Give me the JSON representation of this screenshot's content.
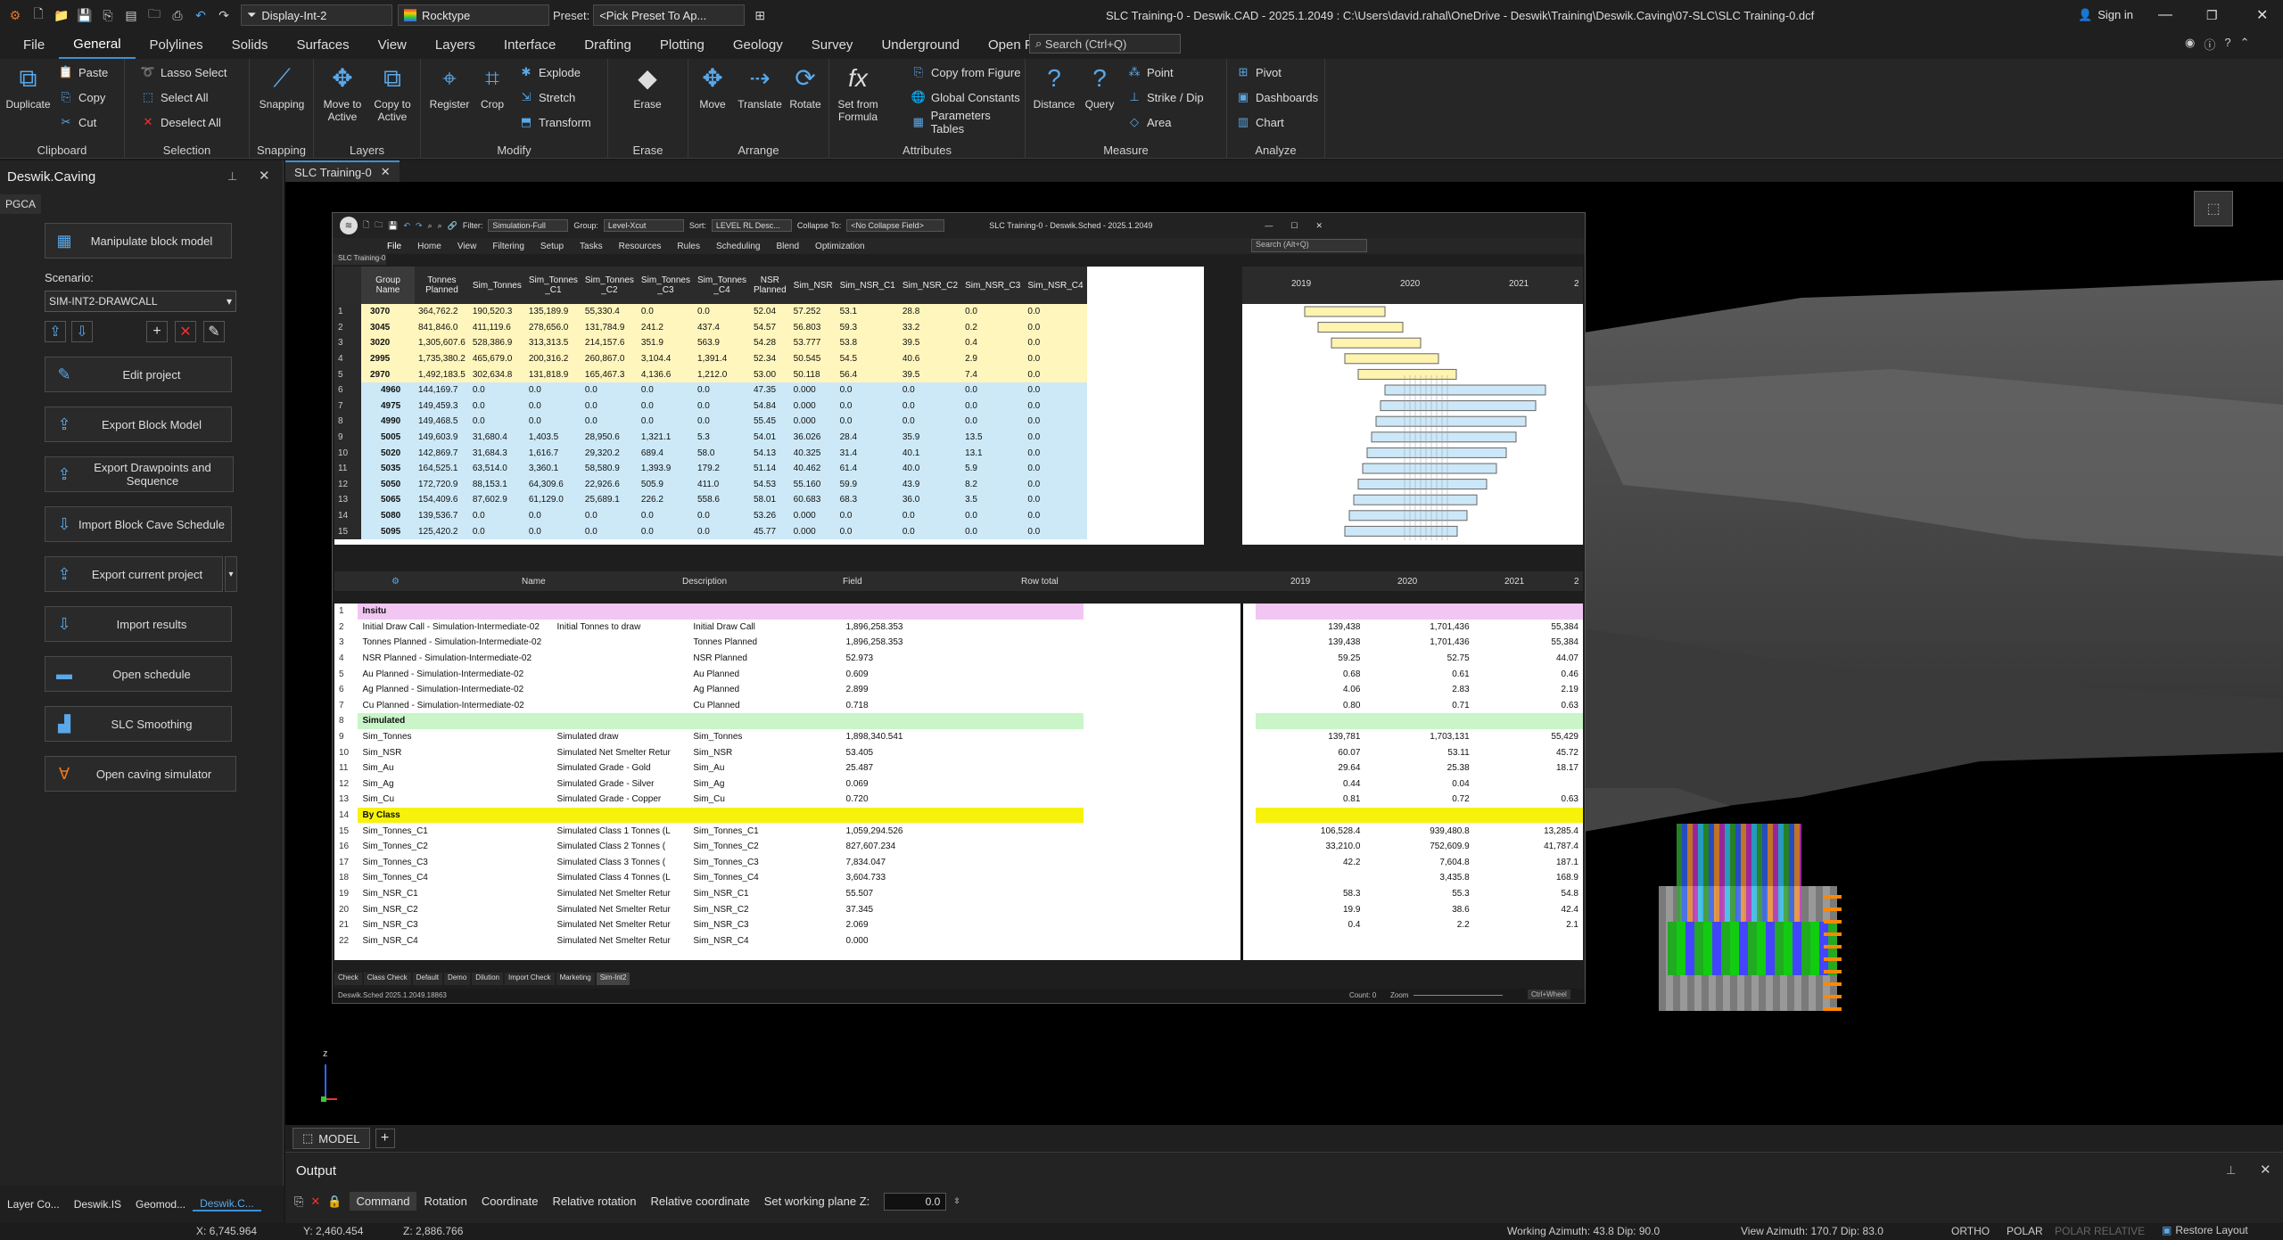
{
  "titlebar": {
    "display": "Display-Int-2",
    "rocktype": "Rocktype",
    "preset_label": "Preset:",
    "preset": "<Pick Preset To Ap...",
    "title": "SLC Training-0 - Deswik.CAD - 2025.1.2049 : C:\\Users\\david.rahal\\OneDrive - Deswik\\Training\\Deswik.Caving\\07-SLC\\SLC Training-0.dcf",
    "signin": "Sign in"
  },
  "tabs": [
    "File",
    "General",
    "Polylines",
    "Solids",
    "Surfaces",
    "View",
    "Layers",
    "Interface",
    "Drafting",
    "Plotting",
    "Geology",
    "Survey",
    "Underground",
    "Open Pit"
  ],
  "search_placeholder": "Search (Ctrl+Q)",
  "ribbon": {
    "groups": [
      "Clipboard",
      "Selection",
      "Snapping",
      "Layers",
      "Modify",
      "Erase",
      "Arrange",
      "Attributes",
      "Measure",
      "Analyze"
    ],
    "duplicate": "Duplicate",
    "paste": "Paste",
    "copy": "Copy",
    "cut": "Cut",
    "lasso": "Lasso Select",
    "select_all": "Select All",
    "deselect_all": "Deselect All",
    "snapping": "Snapping",
    "move_to": "Move to Active",
    "copy_to": "Copy to Active",
    "register": "Register",
    "crop": "Crop",
    "explode": "Explode",
    "stretch": "Stretch",
    "transform": "Transform",
    "erase": "Erase",
    "move": "Move",
    "translate": "Translate",
    "rotate": "Rotate",
    "set_formula": "Set from Formula",
    "copy_fig": "Copy from Figure",
    "global_const": "Global Constants",
    "param_tables": "Parameters Tables",
    "distance": "Distance",
    "query": "Query",
    "point": "Point",
    "strike": "Strike / Dip",
    "area": "Area",
    "pivot": "Pivot",
    "dashboards": "Dashboards",
    "chart": "Chart"
  },
  "left": {
    "title": "Deswik.Caving",
    "subtab": "PGCA",
    "scenario_label": "Scenario:",
    "scenario": "SIM-INT2-DRAWCALL",
    "buttons": [
      "Manipulate block model",
      "Edit project",
      "Export Block Model",
      "Export Drawpoints and Sequence",
      "Import Block Cave Schedule",
      "Export current project",
      "Import results",
      "Open schedule",
      "SLC Smoothing",
      "Open caving simulator"
    ],
    "bottom_tabs": [
      "Layer Co...",
      "Deswik.IS",
      "Geomod...",
      "Deswik.C..."
    ]
  },
  "doc_tab": "SLC Training-0",
  "sched": {
    "filter_label": "Filter:",
    "filter": "Simulation-Full",
    "group_label": "Group:",
    "group": "Level-Xcut",
    "sort_label": "Sort:",
    "sort": "LEVEL RL Desc...",
    "collapse_label": "Collapse To:",
    "collapse": "<No Collapse Field>",
    "title": "SLC Training-0 - Deswik.Sched - 2025.1.2049",
    "menus": [
      "File",
      "Home",
      "View",
      "Filtering",
      "Setup",
      "Tasks",
      "Resources",
      "Rules",
      "Scheduling",
      "Blend",
      "Optimization"
    ],
    "search": "Search (Alt+Q)",
    "doc": "SLC Training-0",
    "headers": [
      "Group Name",
      "Tonnes Planned",
      "Sim_Tonnes",
      "Sim_Tonnes _C1",
      "Sim_Tonnes _C2",
      "Sim_Tonnes _C3",
      "Sim_Tonnes _C4",
      "NSR Planned",
      "Sim_NSR",
      "Sim_NSR_C1",
      "Sim_NSR_C2",
      "Sim_NSR_C3",
      "Sim_NSR_C4"
    ],
    "years": [
      "2019",
      "2020",
      "2021",
      "2"
    ],
    "rows": [
      [
        "1",
        "3070",
        "364,762.2",
        "190,520.3",
        "135,189.9",
        "55,330.4",
        "0.0",
        "0.0",
        "52.04",
        "57.252",
        "53.1",
        "28.8",
        "0.0",
        "0.0"
      ],
      [
        "2",
        "3045",
        "841,846.0",
        "411,119.6",
        "278,656.0",
        "131,784.9",
        "241.2",
        "437.4",
        "54.57",
        "56.803",
        "59.3",
        "33.2",
        "0.2",
        "0.0"
      ],
      [
        "3",
        "3020",
        "1,305,607.6",
        "528,386.9",
        "313,313.5",
        "214,157.6",
        "351.9",
        "563.9",
        "54.28",
        "53.777",
        "53.8",
        "39.5",
        "0.4",
        "0.0"
      ],
      [
        "4",
        "2995",
        "1,735,380.2",
        "465,679.0",
        "200,316.2",
        "260,867.0",
        "3,104.4",
        "1,391.4",
        "52.34",
        "50.545",
        "54.5",
        "40.6",
        "2.9",
        "0.0"
      ],
      [
        "5",
        "2970",
        "1,492,183.5",
        "302,634.8",
        "131,818.9",
        "165,467.3",
        "4,136.6",
        "1,212.0",
        "53.00",
        "50.118",
        "56.4",
        "39.5",
        "7.4",
        "0.0"
      ],
      [
        "6",
        "4960",
        "144,169.7",
        "0.0",
        "0.0",
        "0.0",
        "0.0",
        "0.0",
        "47.35",
        "0.000",
        "0.0",
        "0.0",
        "0.0",
        "0.0"
      ],
      [
        "7",
        "4975",
        "149,459.3",
        "0.0",
        "0.0",
        "0.0",
        "0.0",
        "0.0",
        "54.84",
        "0.000",
        "0.0",
        "0.0",
        "0.0",
        "0.0"
      ],
      [
        "8",
        "4990",
        "149,468.5",
        "0.0",
        "0.0",
        "0.0",
        "0.0",
        "0.0",
        "55.45",
        "0.000",
        "0.0",
        "0.0",
        "0.0",
        "0.0"
      ],
      [
        "9",
        "5005",
        "149,603.9",
        "31,680.4",
        "1,403.5",
        "28,950.6",
        "1,321.1",
        "5.3",
        "54.01",
        "36.026",
        "28.4",
        "35.9",
        "13.5",
        "0.0"
      ],
      [
        "10",
        "5020",
        "142,869.7",
        "31,684.3",
        "1,616.7",
        "29,320.2",
        "689.4",
        "58.0",
        "54.13",
        "40.325",
        "31.4",
        "40.1",
        "13.1",
        "0.0"
      ],
      [
        "11",
        "5035",
        "164,525.1",
        "63,514.0",
        "3,360.1",
        "58,580.9",
        "1,393.9",
        "179.2",
        "51.14",
        "40.462",
        "61.4",
        "40.0",
        "5.9",
        "0.0"
      ],
      [
        "12",
        "5050",
        "172,720.9",
        "88,153.1",
        "64,309.6",
        "22,926.6",
        "505.9",
        "411.0",
        "54.53",
        "55.160",
        "59.9",
        "43.9",
        "8.2",
        "0.0"
      ],
      [
        "13",
        "5065",
        "154,409.6",
        "87,602.9",
        "61,129.0",
        "25,689.1",
        "226.2",
        "558.6",
        "58.01",
        "60.683",
        "68.3",
        "36.0",
        "3.5",
        "0.0"
      ],
      [
        "14",
        "5080",
        "139,536.7",
        "0.0",
        "0.0",
        "0.0",
        "0.0",
        "0.0",
        "53.26",
        "0.000",
        "0.0",
        "0.0",
        "0.0",
        "0.0"
      ],
      [
        "15",
        "5095",
        "125,420.2",
        "0.0",
        "0.0",
        "0.0",
        "0.0",
        "0.0",
        "45.77",
        "0.000",
        "0.0",
        "0.0",
        "0.0",
        "0.0"
      ]
    ],
    "bottom_headers": [
      "Name",
      "Description",
      "Field",
      "Row total",
      "2019",
      "2020",
      "2021",
      "2"
    ],
    "bottom_rows": [
      {
        "n": "1",
        "name": "Insitu",
        "desc": "",
        "field": "",
        "total": "",
        "y1": "",
        "y2": "",
        "y3": "",
        "type": "pink"
      },
      {
        "n": "2",
        "name": "Initial Draw Call - Simulation-Intermediate-02",
        "desc": "Initial Tonnes to draw",
        "field": "Initial Draw Call",
        "total": "1,896,258.353",
        "y1": "139,438",
        "y2": "1,701,436",
        "y3": "55,384",
        "type": ""
      },
      {
        "n": "3",
        "name": "Tonnes Planned - Simulation-Intermediate-02",
        "desc": "",
        "field": "Tonnes Planned",
        "total": "1,896,258.353",
        "y1": "139,438",
        "y2": "1,701,436",
        "y3": "55,384",
        "type": ""
      },
      {
        "n": "4",
        "name": "NSR Planned - Simulation-Intermediate-02",
        "desc": "",
        "field": "NSR Planned",
        "total": "52.973",
        "y1": "59.25",
        "y2": "52.75",
        "y3": "44.07",
        "type": ""
      },
      {
        "n": "5",
        "name": "Au Planned - Simulation-Intermediate-02",
        "desc": "",
        "field": "Au Planned",
        "total": "0.609",
        "y1": "0.68",
        "y2": "0.61",
        "y3": "0.46",
        "type": ""
      },
      {
        "n": "6",
        "name": "Ag Planned - Simulation-Intermediate-02",
        "desc": "",
        "field": "Ag Planned",
        "total": "2.899",
        "y1": "4.06",
        "y2": "2.83",
        "y3": "2.19",
        "type": ""
      },
      {
        "n": "7",
        "name": "Cu Planned - Simulation-Intermediate-02",
        "desc": "",
        "field": "Cu Planned",
        "total": "0.718",
        "y1": "0.80",
        "y2": "0.71",
        "y3": "0.63",
        "type": ""
      },
      {
        "n": "8",
        "name": "Simulated",
        "desc": "",
        "field": "",
        "total": "",
        "y1": "",
        "y2": "",
        "y3": "",
        "type": "green"
      },
      {
        "n": "9",
        "name": "Sim_Tonnes",
        "desc": "Simulated draw",
        "field": "Sim_Tonnes",
        "total": "1,898,340.541",
        "y1": "139,781",
        "y2": "1,703,131",
        "y3": "55,429",
        "type": ""
      },
      {
        "n": "10",
        "name": "Sim_NSR",
        "desc": "Simulated Net Smelter Retur",
        "field": "Sim_NSR",
        "total": "53.405",
        "y1": "60.07",
        "y2": "53.11",
        "y3": "45.72",
        "type": ""
      },
      {
        "n": "11",
        "name": "Sim_Au",
        "desc": "Simulated Grade - Gold",
        "field": "Sim_Au",
        "total": "25.487",
        "y1": "29.64",
        "y2": "25.38",
        "y3": "18.17",
        "type": ""
      },
      {
        "n": "12",
        "name": "Sim_Ag",
        "desc": "Simulated Grade - Silver",
        "field": "Sim_Ag",
        "total": "0.069",
        "y1": "0.44",
        "y2": "0.04",
        "y3": "",
        "type": ""
      },
      {
        "n": "13",
        "name": "Sim_Cu",
        "desc": "Simulated Grade - Copper",
        "field": "Sim_Cu",
        "total": "0.720",
        "y1": "0.81",
        "y2": "0.72",
        "y3": "0.63",
        "type": ""
      },
      {
        "n": "14",
        "name": "By Class",
        "desc": "",
        "field": "",
        "total": "",
        "y1": "",
        "y2": "",
        "y3": "",
        "type": "yellow"
      },
      {
        "n": "15",
        "name": "Sim_Tonnes_C1",
        "desc": "Simulated Class 1 Tonnes (L",
        "field": "Sim_Tonnes_C1",
        "total": "1,059,294.526",
        "y1": "106,528.4",
        "y2": "939,480.8",
        "y3": "13,285.4",
        "type": ""
      },
      {
        "n": "16",
        "name": "Sim_Tonnes_C2",
        "desc": "Simulated Class 2 Tonnes (",
        "field": "Sim_Tonnes_C2",
        "total": "827,607.234",
        "y1": "33,210.0",
        "y2": "752,609.9",
        "y3": "41,787.4",
        "type": ""
      },
      {
        "n": "17",
        "name": "Sim_Tonnes_C3",
        "desc": "Simulated Class 3 Tonnes (",
        "field": "Sim_Tonnes_C3",
        "total": "7,834.047",
        "y1": "42.2",
        "y2": "7,604.8",
        "y3": "187.1",
        "type": ""
      },
      {
        "n": "18",
        "name": "Sim_Tonnes_C4",
        "desc": "Simulated Class 4 Tonnes (L",
        "field": "Sim_Tonnes_C4",
        "total": "3,604.733",
        "y1": "",
        "y2": "3,435.8",
        "y3": "168.9",
        "type": ""
      },
      {
        "n": "19",
        "name": "Sim_NSR_C1",
        "desc": "Simulated Net Smelter Retur",
        "field": "Sim_NSR_C1",
        "total": "55.507",
        "y1": "58.3",
        "y2": "55.3",
        "y3": "54.8",
        "type": ""
      },
      {
        "n": "20",
        "name": "Sim_NSR_C2",
        "desc": "Simulated Net Smelter Retur",
        "field": "Sim_NSR_C2",
        "total": "37.345",
        "y1": "19.9",
        "y2": "38.6",
        "y3": "42.4",
        "type": ""
      },
      {
        "n": "21",
        "name": "Sim_NSR_C3",
        "desc": "Simulated Net Smelter Retur",
        "field": "Sim_NSR_C3",
        "total": "2.069",
        "y1": "0.4",
        "y2": "2.2",
        "y3": "2.1",
        "type": ""
      },
      {
        "n": "22",
        "name": "Sim_NSR_C4",
        "desc": "Simulated Net Smelter Retur",
        "field": "Sim_NSR_C4",
        "total": "0.000",
        "y1": "",
        "y2": "",
        "y3": "",
        "type": ""
      }
    ],
    "sheet_tabs": [
      "Check",
      "Class Check",
      "Default",
      "Demo",
      "Dilution",
      "Import Check",
      "Marketing",
      "Sim-Int2"
    ],
    "status": "Deswik.Sched 2025.1.2049.18863",
    "count": "Count: 0",
    "zoom": "Zoom",
    "ctrl": "Ctrl+Wheel"
  },
  "model_tab": "MODEL",
  "output": {
    "title": "Output",
    "tabs": [
      "Command",
      "Rotation",
      "Coordinate",
      "Relative rotation",
      "Relative coordinate",
      "Set working plane Z:"
    ],
    "z_value": "0.0"
  },
  "status": {
    "x": "X: 6,745.964",
    "y": "Y: 2,460.454",
    "z": "Z: 2,886.766",
    "working": "Working Azimuth: 43.8 Dip: 90.0",
    "view": "View Azimuth: 170.7 Dip: 83.0",
    "ortho": "ORTHO",
    "polar": "POLAR",
    "polar_rel": "POLAR RELATIVE",
    "restore": "Restore Layout"
  }
}
